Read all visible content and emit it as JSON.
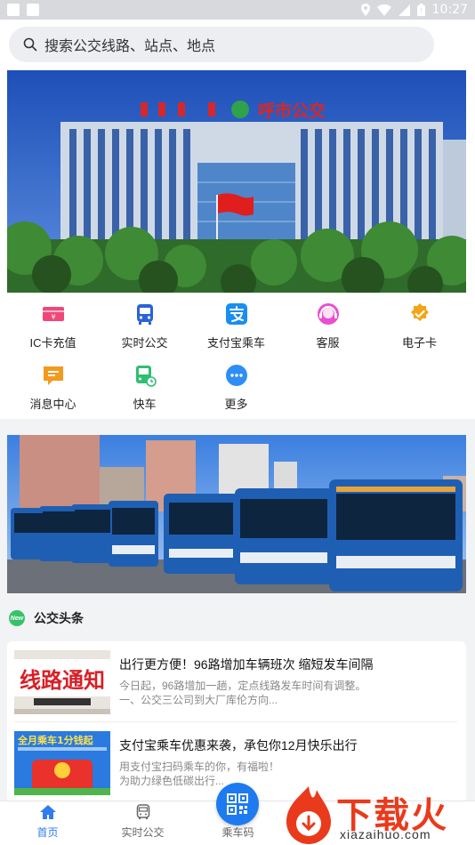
{
  "status_bar": {
    "time": "10:27"
  },
  "search": {
    "placeholder": "搜索公交线路、站点、地点"
  },
  "banner1": {
    "sign_text": "呼市公交"
  },
  "quick_actions": [
    {
      "label": "IC卡充值",
      "icon": "ic-card-icon",
      "color": "#f0477a"
    },
    {
      "label": "实时公交",
      "icon": "bus-icon",
      "color": "#2a63d8"
    },
    {
      "label": "支付宝乘车",
      "icon": "alipay-icon",
      "color": "#1a8ef0"
    },
    {
      "label": "客服",
      "icon": "customer-service-icon",
      "color": "#e94fd0"
    },
    {
      "label": "电子卡",
      "icon": "e-card-badge-icon",
      "color": "#f2a516"
    },
    {
      "label": "消息中心",
      "icon": "message-icon",
      "color": "#f39a1e"
    },
    {
      "label": "快车",
      "icon": "express-bus-icon",
      "color": "#2fbf72"
    },
    {
      "label": "更多",
      "icon": "more-icon",
      "color": "#2f8ef5"
    }
  ],
  "news": {
    "logo_text": "New",
    "title": "公交头条",
    "items": [
      {
        "title": "出行更方便！96路增加车辆班次 缩短发车间隔",
        "desc1": "今日起，96路增加一趟，定点线路发车时间有调整。",
        "desc2": "一、公交三公司到大厂库伦方向...",
        "thumb_text": "线路通知"
      },
      {
        "title": "支付宝乘车优惠来袭，承包你12月快乐出行",
        "desc1": "用支付宝扫码乘车的你，有福啦！",
        "desc2": "为助力绿色低碳出行...",
        "thumb_text": "全月乘车1分钱起"
      }
    ]
  },
  "tabbar": {
    "items": [
      {
        "label": "首页",
        "active": true
      },
      {
        "label": "实时公交",
        "active": false
      },
      {
        "label": "乘车码",
        "active": false
      }
    ]
  },
  "watermark": {
    "text": "下载火",
    "url": "xiazaihuo.com"
  }
}
